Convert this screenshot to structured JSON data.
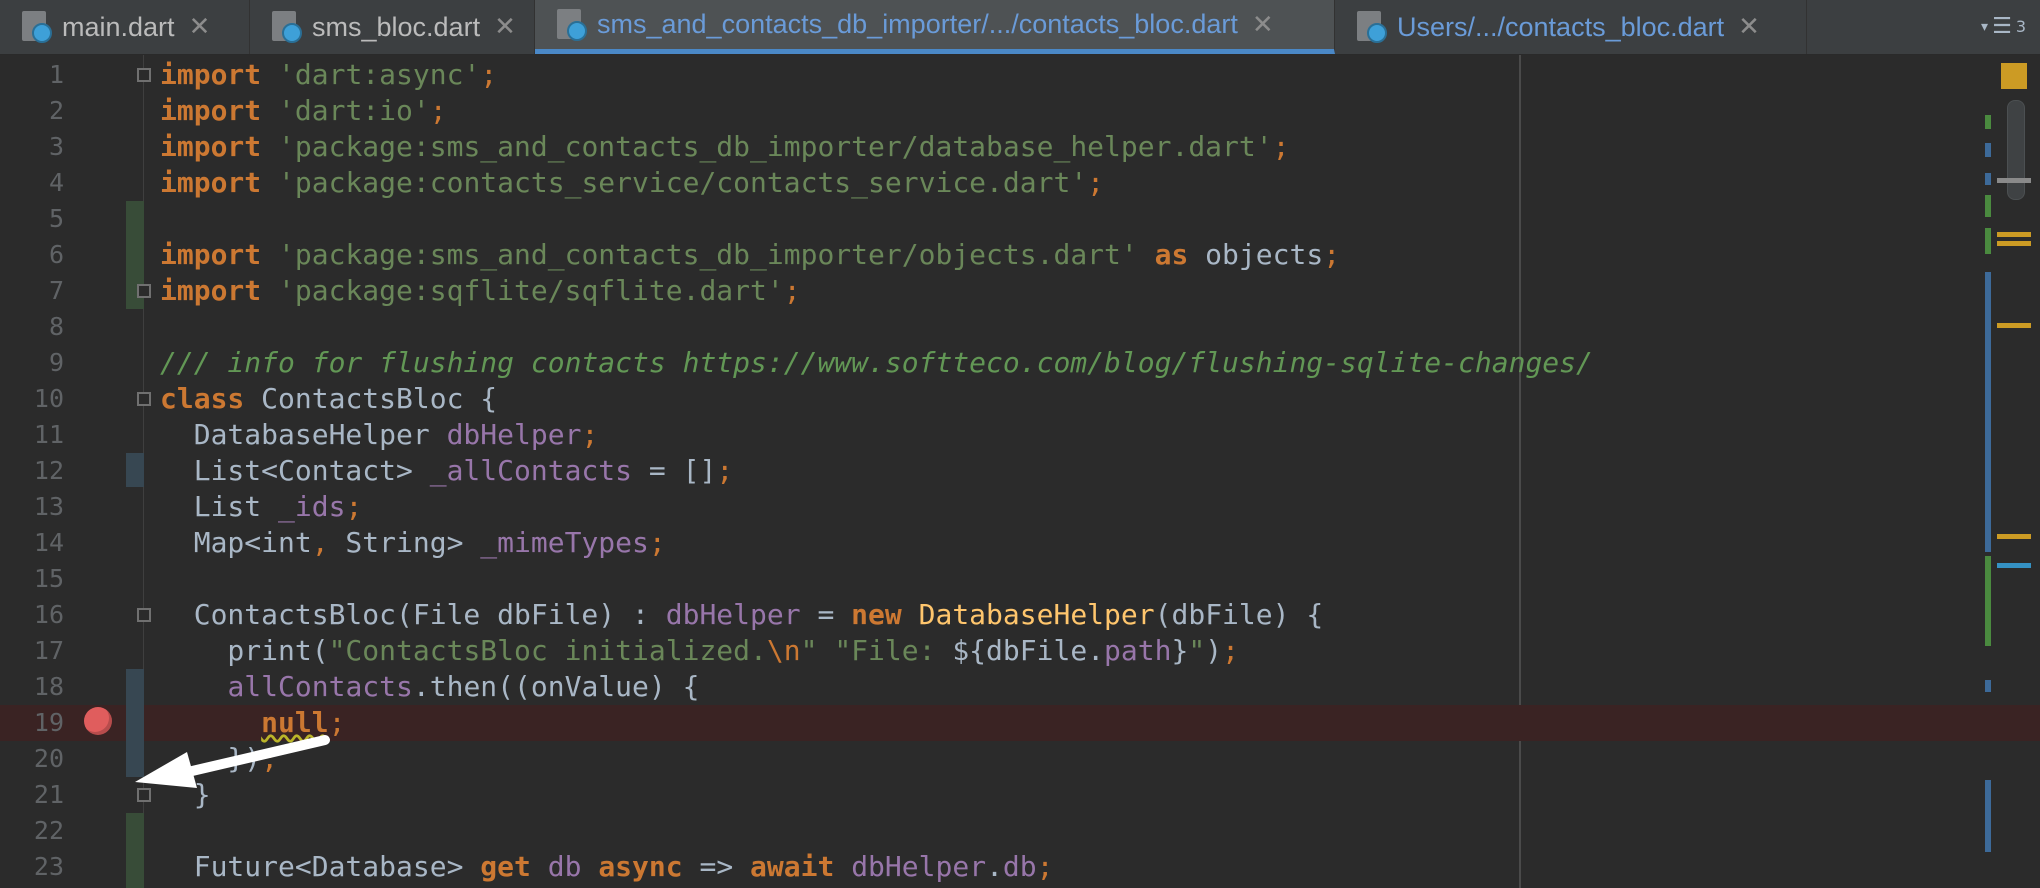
{
  "tabs": [
    {
      "label": "main.dart",
      "active": false
    },
    {
      "label": "sms_bloc.dart",
      "active": false
    },
    {
      "label": "sms_and_contacts_db_importer/.../contacts_bloc.dart",
      "active": true
    },
    {
      "label": "Users/.../contacts_bloc.dart",
      "active": false
    }
  ],
  "tab_menu": {
    "icon": "tab-list-icon",
    "count": "3"
  },
  "colors": {
    "keyword": "#cc7832",
    "string": "#6a8759",
    "field": "#9876aa",
    "comment": "#629755",
    "function": "#ffc66d",
    "text": "#a9b7c6",
    "breakpoint": "#e05d5d",
    "active_tab_accent": "#4a88c7"
  },
  "editor": {
    "breakpoint_line": 19,
    "lines": [
      {
        "n": "1",
        "t": [
          {
            "k": "kw",
            "v": "import"
          },
          {
            "k": "",
            "v": " "
          },
          {
            "k": "str",
            "v": "'dart:async'"
          },
          {
            "k": "sc",
            "v": ";"
          }
        ]
      },
      {
        "n": "2",
        "t": [
          {
            "k": "kw",
            "v": "import"
          },
          {
            "k": "",
            "v": " "
          },
          {
            "k": "str",
            "v": "'dart:io'"
          },
          {
            "k": "sc",
            "v": ";"
          }
        ]
      },
      {
        "n": "3",
        "t": [
          {
            "k": "kw",
            "v": "import"
          },
          {
            "k": "",
            "v": " "
          },
          {
            "k": "str",
            "v": "'package:sms_and_contacts_db_importer/database_helper.dart'"
          },
          {
            "k": "sc",
            "v": ";"
          }
        ]
      },
      {
        "n": "4",
        "t": [
          {
            "k": "kw",
            "v": "import"
          },
          {
            "k": "",
            "v": " "
          },
          {
            "k": "str",
            "v": "'package:contacts_service/contacts_service.dart'"
          },
          {
            "k": "sc",
            "v": ";"
          }
        ]
      },
      {
        "n": "5",
        "t": []
      },
      {
        "n": "6",
        "t": [
          {
            "k": "kw",
            "v": "import"
          },
          {
            "k": "",
            "v": " "
          },
          {
            "k": "str",
            "v": "'package:sms_and_contacts_db_importer/objects.dart'"
          },
          {
            "k": "",
            "v": " "
          },
          {
            "k": "kw",
            "v": "as"
          },
          {
            "k": "",
            "v": " objects"
          },
          {
            "k": "sc",
            "v": ";"
          }
        ]
      },
      {
        "n": "7",
        "t": [
          {
            "k": "kw",
            "v": "import"
          },
          {
            "k": "",
            "v": " "
          },
          {
            "k": "str",
            "v": "'package:sqflite/sqflite.dart'"
          },
          {
            "k": "sc",
            "v": ";"
          }
        ]
      },
      {
        "n": "8",
        "t": []
      },
      {
        "n": "9",
        "t": [
          {
            "k": "cmt",
            "v": "/// info for flushing contacts https://www.softteco.com/blog/flushing-sqlite-changes/"
          }
        ]
      },
      {
        "n": "10",
        "t": [
          {
            "k": "kw",
            "v": "class"
          },
          {
            "k": "",
            "v": " ContactsBloc {"
          }
        ]
      },
      {
        "n": "11",
        "t": [
          {
            "k": "",
            "v": "  DatabaseHelper "
          },
          {
            "k": "fld",
            "v": "dbHelper"
          },
          {
            "k": "sc",
            "v": ";"
          }
        ]
      },
      {
        "n": "12",
        "t": [
          {
            "k": "",
            "v": "  List<Contact> "
          },
          {
            "k": "fld",
            "v": "_allContacts"
          },
          {
            "k": "",
            "v": " = []"
          },
          {
            "k": "sc",
            "v": ";"
          }
        ]
      },
      {
        "n": "13",
        "t": [
          {
            "k": "",
            "v": "  List "
          },
          {
            "k": "fld",
            "v": "_ids"
          },
          {
            "k": "sc",
            "v": ";"
          }
        ]
      },
      {
        "n": "14",
        "t": [
          {
            "k": "",
            "v": "  Map<int"
          },
          {
            "k": "sc",
            "v": ","
          },
          {
            "k": "",
            "v": " String> "
          },
          {
            "k": "fld",
            "v": "_mimeTypes"
          },
          {
            "k": "sc",
            "v": ";"
          }
        ]
      },
      {
        "n": "15",
        "t": []
      },
      {
        "n": "16",
        "t": [
          {
            "k": "",
            "v": "  ContactsBloc(File dbFile) : "
          },
          {
            "k": "fld",
            "v": "dbHelper"
          },
          {
            "k": "",
            "v": " = "
          },
          {
            "k": "kw",
            "v": "new"
          },
          {
            "k": "",
            "v": " "
          },
          {
            "k": "fn",
            "v": "DatabaseHelper"
          },
          {
            "k": "",
            "v": "(dbFile) {"
          }
        ]
      },
      {
        "n": "17",
        "t": [
          {
            "k": "",
            "v": "    print("
          },
          {
            "k": "str",
            "v": "\"ContactsBloc initialized."
          },
          {
            "k": "esc",
            "v": "\\n"
          },
          {
            "k": "str",
            "v": "\""
          },
          {
            "k": "",
            "v": " "
          },
          {
            "k": "str",
            "v": "\"File: "
          },
          {
            "k": "",
            "v": "${dbFile."
          },
          {
            "k": "fld",
            "v": "path"
          },
          {
            "k": "",
            "v": "}"
          },
          {
            "k": "str",
            "v": "\""
          },
          {
            "k": "",
            "v": ")"
          },
          {
            "k": "sc",
            "v": ";"
          }
        ]
      },
      {
        "n": "18",
        "t": [
          {
            "k": "",
            "v": "    "
          },
          {
            "k": "fld",
            "v": "allContacts"
          },
          {
            "k": "",
            "v": ".then((onValue) {"
          }
        ]
      },
      {
        "n": "19",
        "t": [
          {
            "k": "",
            "v": "      "
          },
          {
            "k": "kw warn",
            "v": "null"
          },
          {
            "k": "sc",
            "v": ";"
          }
        ]
      },
      {
        "n": "20",
        "t": [
          {
            "k": "",
            "v": "    })"
          },
          {
            "k": "sc",
            "v": ";"
          }
        ]
      },
      {
        "n": "21",
        "t": [
          {
            "k": "",
            "v": "  }"
          }
        ]
      },
      {
        "n": "22",
        "t": []
      },
      {
        "n": "23",
        "t": [
          {
            "k": "",
            "v": "  Future<Database> "
          },
          {
            "k": "kw",
            "v": "get"
          },
          {
            "k": "",
            "v": " "
          },
          {
            "k": "fld",
            "v": "db"
          },
          {
            "k": "",
            "v": " "
          },
          {
            "k": "kw",
            "v": "async"
          },
          {
            "k": "",
            "v": " => "
          },
          {
            "k": "kw",
            "v": "await"
          },
          {
            "k": "",
            "v": " "
          },
          {
            "k": "fld",
            "v": "dbHelper"
          },
          {
            "k": "",
            "v": "."
          },
          {
            "k": "fld",
            "v": "db"
          },
          {
            "k": "sc",
            "v": ";"
          }
        ]
      }
    ]
  }
}
